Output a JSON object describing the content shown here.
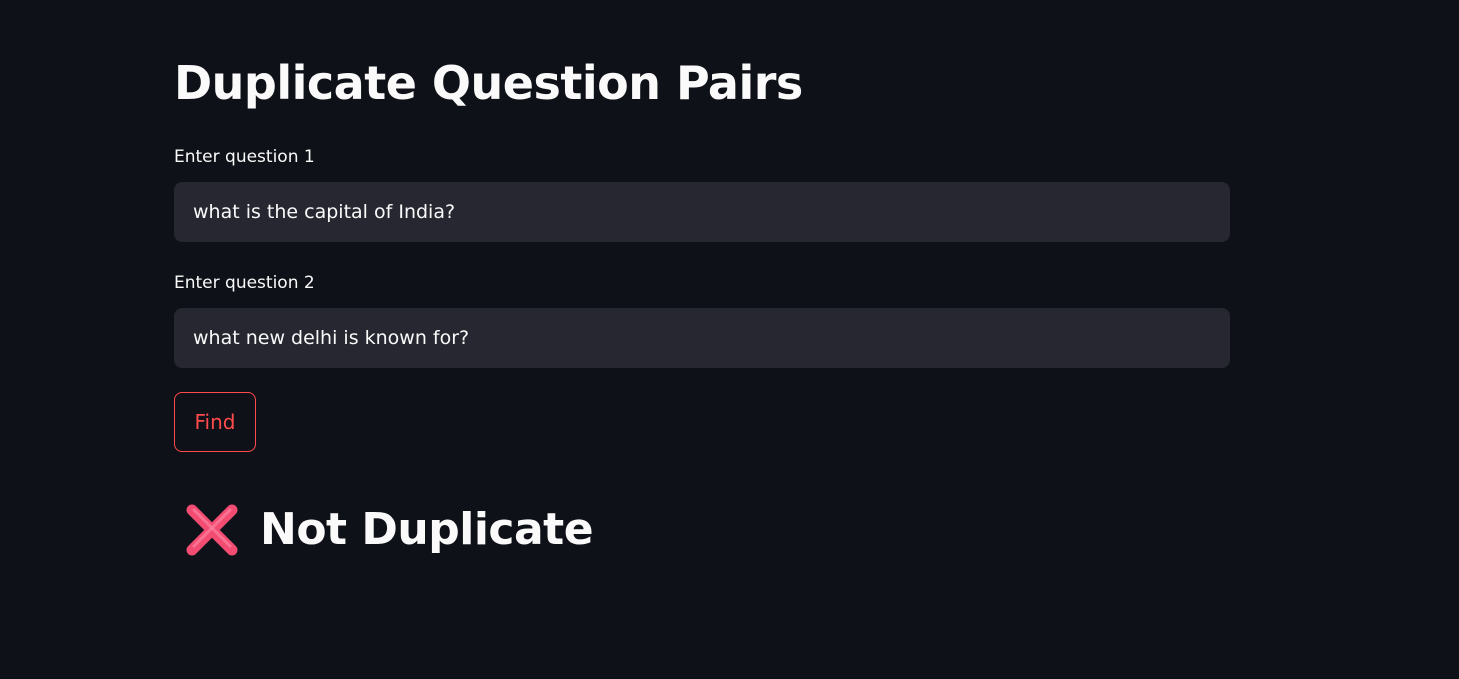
{
  "page": {
    "title": "Duplicate Question Pairs"
  },
  "form": {
    "question1": {
      "label": "Enter question 1",
      "value": "what is the capital of India?"
    },
    "question2": {
      "label": "Enter question 2",
      "value": "what new delhi is known for?"
    },
    "find_button_label": "Find"
  },
  "result": {
    "icon": "cross-mark-icon",
    "text": "Not Duplicate"
  },
  "colors": {
    "background": "#0e1117",
    "input_background": "#262730",
    "accent": "#ff4b4b",
    "result_icon": "#f24c73"
  }
}
